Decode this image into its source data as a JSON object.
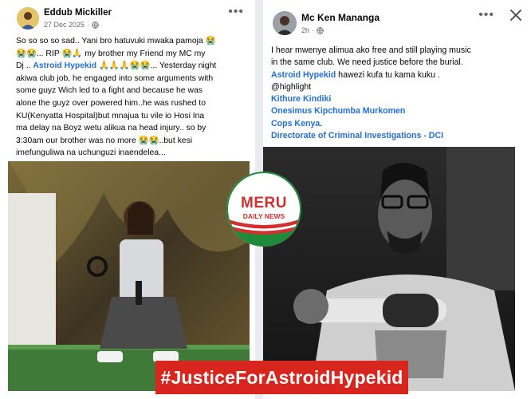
{
  "left_post": {
    "author": "Eddub Mickiller",
    "date": "27 Dec 2025",
    "separator": "·",
    "text": {
      "l1": "So so so so sad.. Yani bro hatuvuki mwaka pamoja 😭",
      "l2a": "😭😭... RIP 😭🙏 my brother my Friend my MC my",
      "l3a": "Dj .. ",
      "mention": "Astroid Hypekid",
      "l3b": " 🙏🙏🙏😭😭... Yesterday night",
      "l4": "akiwa club job, he engaged into some arguments with",
      "l5": "some guyz Wich led to a fight and because he was",
      "l6": "alone the guyz over powered him..he was rushed to",
      "l7": "KU(Kenyatta Hospital)but mnajua tu vile io Hosi Ina",
      "l8": "ma delay na Boyz wetu alikua na head injury.. so by",
      "l9": "3:30am our brother was no more 😭😭..but kesi",
      "l10": "imefunguliwa na uchunguzi inaendelea..."
    }
  },
  "right_post": {
    "author": "Mc Ken Mananga",
    "time": "2h",
    "separator": "·",
    "text": {
      "l1": "I hear mwenye alimua ako free and still playing music",
      "l2": "in the same club. We need justice before the burial.",
      "mention1": "Astroid Hypekid",
      "l3b": " hawezi kufa tu kama kuku .",
      "l4": "@highlight",
      "mention2": "Kithure Kindiki",
      "mention3": "Onesimus Kipchumba Murkomen",
      "mention4": "Cops Kenya.",
      "mention5": "Directorate of Criminal Investigations - DCI"
    }
  },
  "logo": {
    "line1": "MERU",
    "line2": "DAILY NEWS"
  },
  "banner": {
    "text": "#JusticeForAstroidHypekid"
  },
  "colors": {
    "link": "#216fdb",
    "banner": "#d8251d",
    "logo_red": "#d32f2f",
    "logo_green": "#1f8a3a"
  }
}
